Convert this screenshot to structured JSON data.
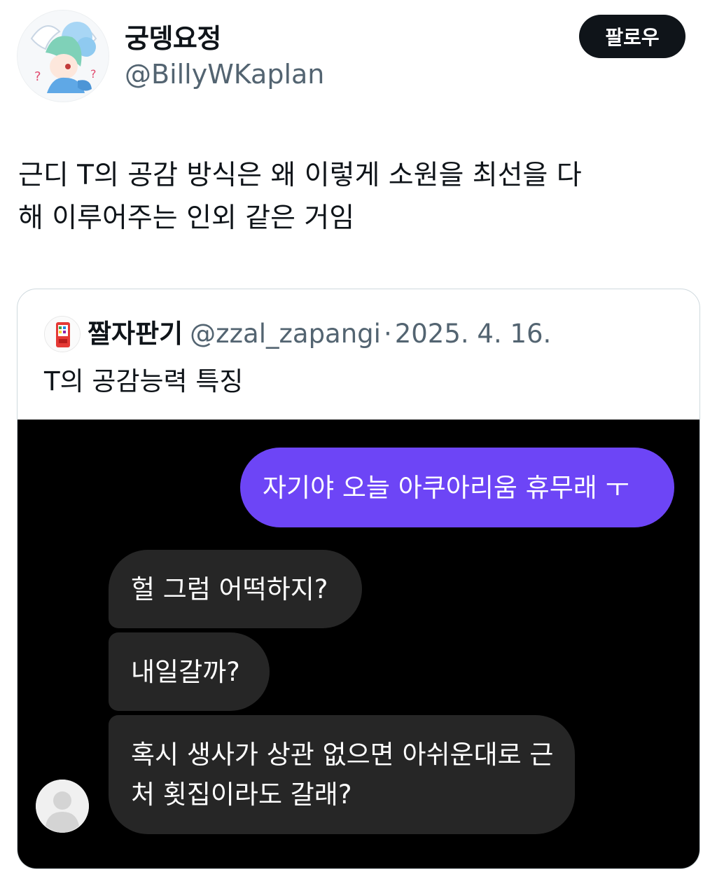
{
  "author": {
    "display_name": "궁뎅요정",
    "handle": "@BillyWKaplan",
    "avatar_icon": "anime-character-avatar-icon"
  },
  "follow_button": {
    "label": "팔로우"
  },
  "tweet": {
    "text_line1": "근디 T의 공감 방식은 왜 이렇게 소원을 최선을 다",
    "text_line2": "해 이루어주는 인외 같은 거임"
  },
  "quoted_tweet": {
    "display_name": "짤자판기",
    "handle": "@zzal_zapangi",
    "separator": "·",
    "date": "2025. 4. 16.",
    "avatar_icon": "vending-machine-icon",
    "text": "T의 공감능력 특징"
  },
  "chat": {
    "sent_message": "자기야 오늘 아쿠아리움 휴무래 ㅜ",
    "received_messages": [
      "헐 그럼 어떡하지?",
      "내일갈까?",
      "혹시 생사가 상관 없으면 아쉬운대로 근처 횟집이라도 갈래?"
    ],
    "colors": {
      "background": "#000000",
      "sent_bubble": "#6d45f6",
      "received_bubble": "#262626"
    }
  },
  "colors": {
    "text_primary": "#0f1419",
    "text_secondary": "#536471",
    "follow_button_bg": "#0f1419",
    "card_border": "#cfd9de"
  }
}
